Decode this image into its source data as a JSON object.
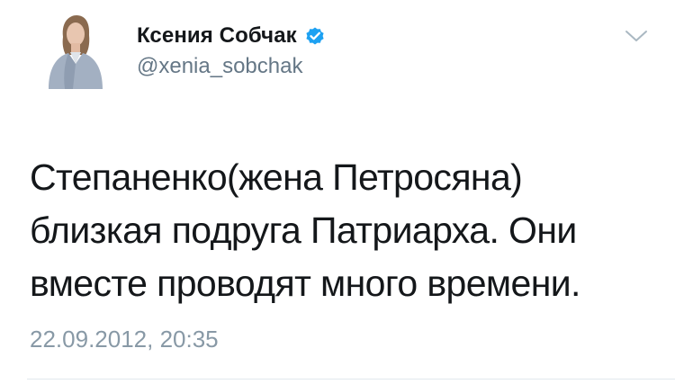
{
  "tweet": {
    "author": {
      "display_name": "Ксения Собчак",
      "handle": "@xenia_sobchak",
      "verified": true,
      "avatar_icon": "user-avatar-photo"
    },
    "text_lines": [
      "Степаненко(жена Петросяна)",
      "близкая подруга Патриарха. Они",
      "вместе проводят много времени."
    ],
    "timestamp": "22.09.2012, 20:35",
    "menu_icon": "chevron-down-icon"
  },
  "colors": {
    "name": "#14171a",
    "secondary": "#657786",
    "timestamp": "#8899a6",
    "verified_badge": "#1da1f2",
    "divider": "#e1e8ed"
  }
}
